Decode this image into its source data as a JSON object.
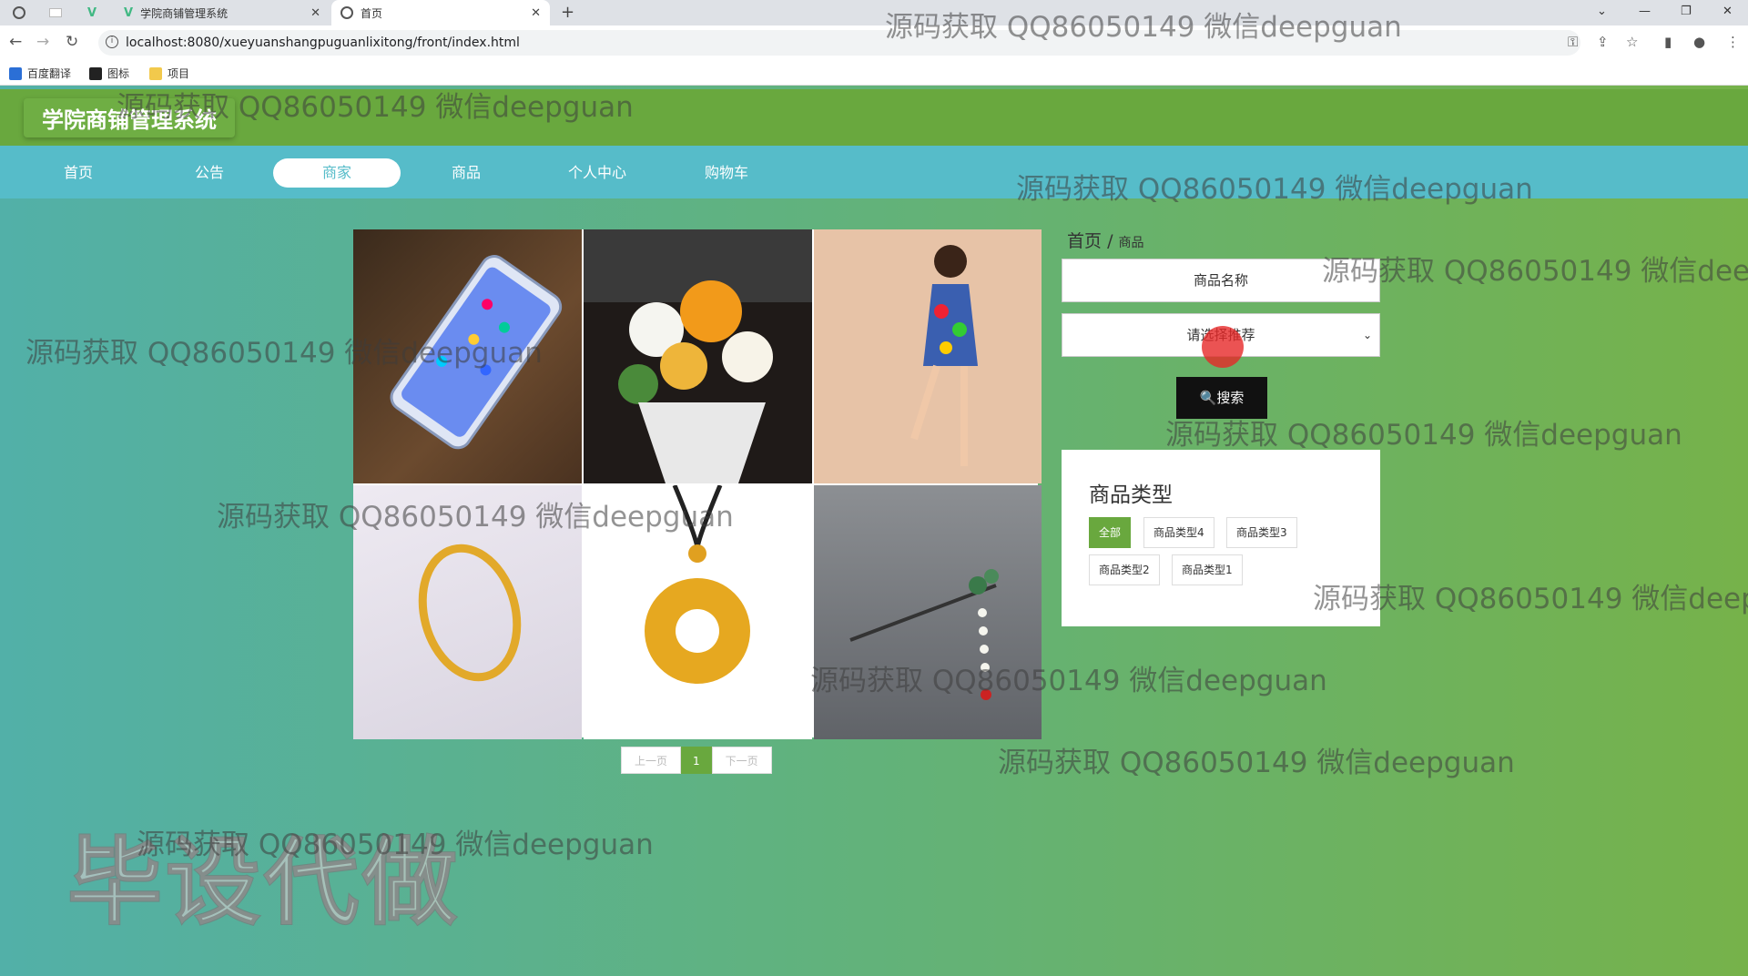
{
  "browser": {
    "tabs": [
      {
        "title": "学院商铺管理系统"
      },
      {
        "title": "首页"
      }
    ],
    "url": "localhost:8080/xueyuanshangpuguanlixitong/front/index.html",
    "bookmarks": [
      "百度翻译",
      "图标",
      "项目"
    ]
  },
  "site": {
    "logo": "学院商铺管理系统",
    "nav": [
      "首页",
      "公告",
      "商家",
      "商品",
      "个人中心",
      "购物车"
    ],
    "active_nav_index": 2
  },
  "breadcrumb": {
    "home": "首页",
    "sep": "/",
    "current": "商品"
  },
  "filters": {
    "name_placeholder": "商品名称",
    "recommend_placeholder": "请选择推荐",
    "search_label": "🔍搜索"
  },
  "types": {
    "title": "商品类型",
    "tags": [
      "全部",
      "商品类型4",
      "商品类型3",
      "商品类型2",
      "商品类型1"
    ]
  },
  "products": [
    "phone",
    "flower-bouquet",
    "floral-dress",
    "gold-ring",
    "gold-pendant",
    "hairpin"
  ],
  "pager": {
    "prev": "上一页",
    "current": "1",
    "next": "下一页"
  },
  "watermarks": {
    "text": "源码获取 QQ86050149 微信deepguan",
    "cut": "源码获取 QQ86050149 微信deepg",
    "big": "毕设代做"
  },
  "colors": {
    "header": "#69a83e",
    "nav": "#56bcc9",
    "accent": "#69a83e"
  }
}
